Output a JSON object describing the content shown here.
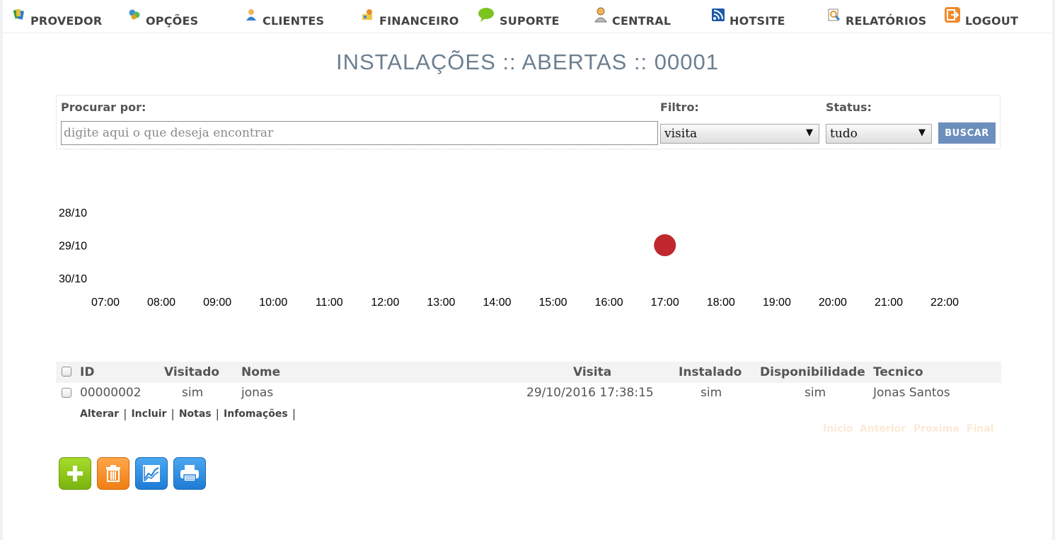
{
  "nav": {
    "items": [
      {
        "label": "PROVEDOR",
        "icon": "provider-icon"
      },
      {
        "label": "OPÇÕES",
        "icon": "options-icon"
      },
      {
        "label": "CLIENTES",
        "icon": "clients-icon"
      },
      {
        "label": "FINANCEIRO",
        "icon": "finance-icon"
      },
      {
        "label": "SUPORTE",
        "icon": "support-icon"
      },
      {
        "label": "CENTRAL",
        "icon": "central-icon"
      },
      {
        "label": "HOTSITE",
        "icon": "hotsite-icon"
      },
      {
        "label": "RELATÓRIOS",
        "icon": "reports-icon"
      },
      {
        "label": "LOGOUT",
        "icon": "logout-icon"
      }
    ]
  },
  "page": {
    "title": "INSTALAÇÕES :: ABERTAS :: 00001"
  },
  "search": {
    "label": "Procurar por:",
    "placeholder": "digite aqui o que deseja encontrar",
    "filter_label": "Filtro:",
    "filter_value": "visita",
    "status_label": "Status:",
    "status_value": "tudo",
    "button_label": "BUSCAR"
  },
  "chart_data": {
    "type": "scatter",
    "y_categories": [
      "28/10",
      "29/10",
      "30/10"
    ],
    "x_categories": [
      "07:00",
      "08:00",
      "09:00",
      "10:00",
      "11:00",
      "12:00",
      "13:00",
      "14:00",
      "15:00",
      "16:00",
      "17:00",
      "18:00",
      "19:00",
      "20:00",
      "21:00",
      "22:00"
    ],
    "points": [
      {
        "x": "17:00",
        "y": "29/10"
      }
    ],
    "point_color": "#c0282d"
  },
  "table": {
    "columns": [
      "ID",
      "Visitado",
      "Nome",
      "Visita",
      "Instalado",
      "Disponibilidade",
      "Tecnico"
    ],
    "rows": [
      {
        "id": "00000002",
        "visitado": "sim",
        "nome": "jonas",
        "visita": "29/10/2016 17:38:15",
        "instalado": "sim",
        "disponibilidade": "sim",
        "tecnico": "Jonas Santos"
      }
    ],
    "row_actions": [
      "Alterar",
      "Incluir",
      "Notas",
      "Infomações"
    ]
  },
  "pagination": {
    "first": "Inicio",
    "prev": "Anterior",
    "next": "Proxima",
    "last": "Final"
  },
  "actions": [
    {
      "name": "add",
      "icon": "plus-icon",
      "color": "#8cc414"
    },
    {
      "name": "delete",
      "icon": "trash-icon",
      "color": "#f5891f"
    },
    {
      "name": "chart",
      "icon": "chart-icon",
      "color": "#2d8ee0"
    },
    {
      "name": "print",
      "icon": "printer-icon",
      "color": "#2d8ee0"
    }
  ]
}
